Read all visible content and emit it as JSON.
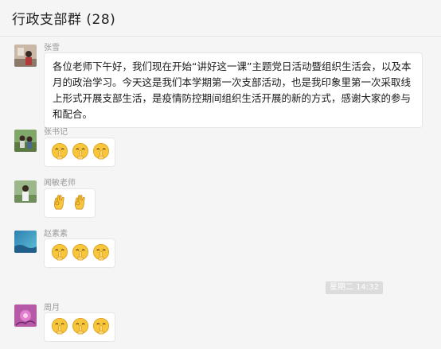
{
  "header": {
    "title": "行政支部群 (28)"
  },
  "messages": [
    {
      "sender": "张雪",
      "text": "各位老师下午好，我们现在开始“讲好这一课”主题党日活动暨组织生活会，以及本月的政治学习。今天这是我们本学期第一次支部活动，也是我印象里第一次采取线上形式开展支部生活，是疫情防控期间组织生活开展的新的方式，感谢大家的参与和配合。"
    },
    {
      "sender": "张书记",
      "emoji": "shh-face",
      "count": 3
    },
    {
      "sender": "闻敏老师",
      "emoji": "ok-hand",
      "count": 2
    },
    {
      "sender": "赵素素",
      "emoji": "shh-face",
      "count": 3
    },
    {
      "sender": "周月",
      "emoji": "shh-face",
      "count": 3
    }
  ],
  "timestamp": "星期二 14:32",
  "icons": {
    "shh-face": "shushing-face-icon",
    "ok-hand": "ok-hand-icon"
  },
  "colors": {
    "background": "#f5f5f5",
    "bubble": "#ffffff",
    "sender": "#9a9a9a",
    "timestamp_bg": "#dcdcdc"
  }
}
